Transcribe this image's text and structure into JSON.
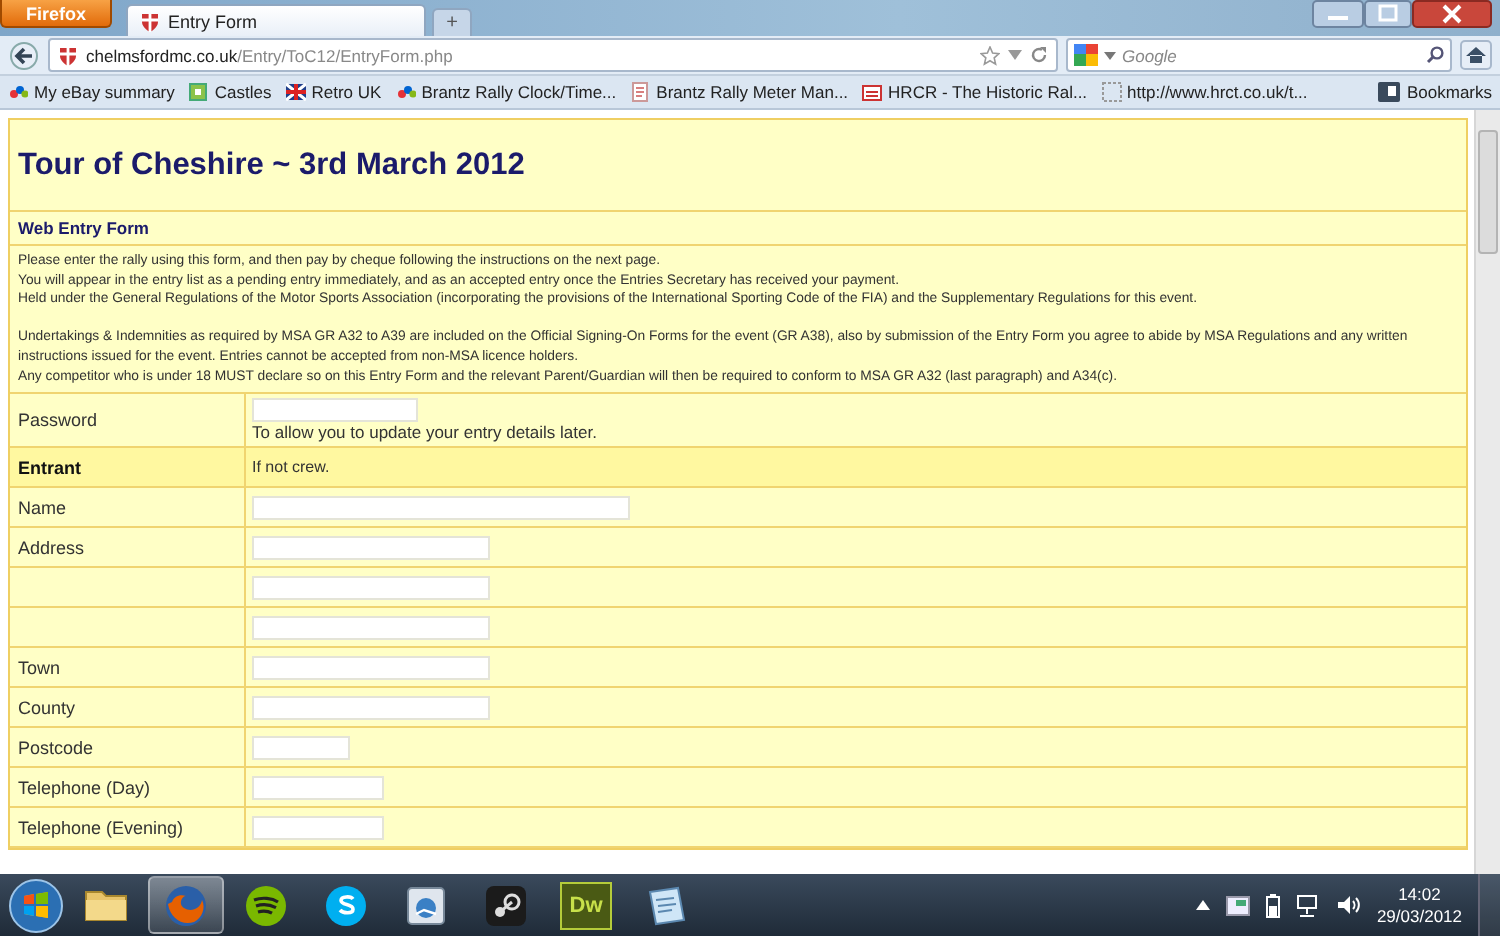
{
  "browser": {
    "menu_button": "Firefox",
    "tabs": [
      {
        "label": "Entry Form",
        "selected": true
      }
    ],
    "new_tab": "+",
    "url_host": "chelmsfordmc.co.uk",
    "url_path": "/Entry/ToC12/EntryForm.php",
    "search": {
      "placeholder": "Google"
    },
    "bookmarks": [
      {
        "label": "My eBay summary"
      },
      {
        "label": "Castles"
      },
      {
        "label": "Retro UK"
      },
      {
        "label": "Brantz Rally Clock/Time..."
      },
      {
        "label": "Brantz Rally Meter Man..."
      },
      {
        "label": "HRCR - The Historic Ral..."
      },
      {
        "label": "http://www.hrct.co.uk/t..."
      }
    ],
    "bookmarks_menu": "Bookmarks"
  },
  "page": {
    "title": "Tour of Cheshire ~ 3rd March 2012",
    "subtitle": "Web Entry Form",
    "paragraphs": [
      [
        "Please enter the rally using this form, and then pay by cheque following the instructions on the next page.",
        "You will appear in the entry list as a pending entry immediately, and as an accepted entry once the Entries Secretary has received your payment.",
        "Held under the General Regulations of the Motor Sports Association (incorporating the provisions of the International Sporting Code of the FIA) and the Supplementary Regulations for this event."
      ],
      [
        "Undertakings & Indemnities as required by MSA GR A32 to A39 are included on the Official Signing-On Forms for the event (GR A38), also by submission of the Entry Form you agree to abide by MSA Regulations and any written instructions issued for the event. Entries cannot be accepted from non-MSA licence holders.",
        "Any competitor who is under 18 MUST declare so on this Entry Form and the relevant Parent/Guardian will then be required to conform to MSA GR A32 (last paragraph) and A34(c)."
      ]
    ],
    "rows": [
      {
        "kind": "medium",
        "label": "Password",
        "note": "To allow you to update your entry details later."
      },
      {
        "kind": "heading",
        "label": "Entrant",
        "note": "If not crew."
      },
      {
        "kind": "long",
        "label": "Name"
      },
      {
        "kind": "wide",
        "label": "Address"
      },
      {
        "kind": "wide"
      },
      {
        "kind": "wide"
      },
      {
        "kind": "wide",
        "label": "Town"
      },
      {
        "kind": "wide",
        "label": "County"
      },
      {
        "kind": "short",
        "label": "Postcode"
      },
      {
        "kind": "small",
        "label": "Telephone (Day)"
      },
      {
        "kind": "small",
        "label": "Telephone (Evening)"
      }
    ]
  },
  "taskbar": {
    "apps": [
      {
        "selected": false
      },
      {
        "selected": true
      },
      {
        "selected": false
      },
      {
        "selected": false
      },
      {
        "selected": false
      },
      {
        "selected": false
      },
      {
        "label": "Dw",
        "selected": false
      },
      {
        "selected": false
      }
    ],
    "time": "14:02",
    "date": "29/03/2012"
  }
}
